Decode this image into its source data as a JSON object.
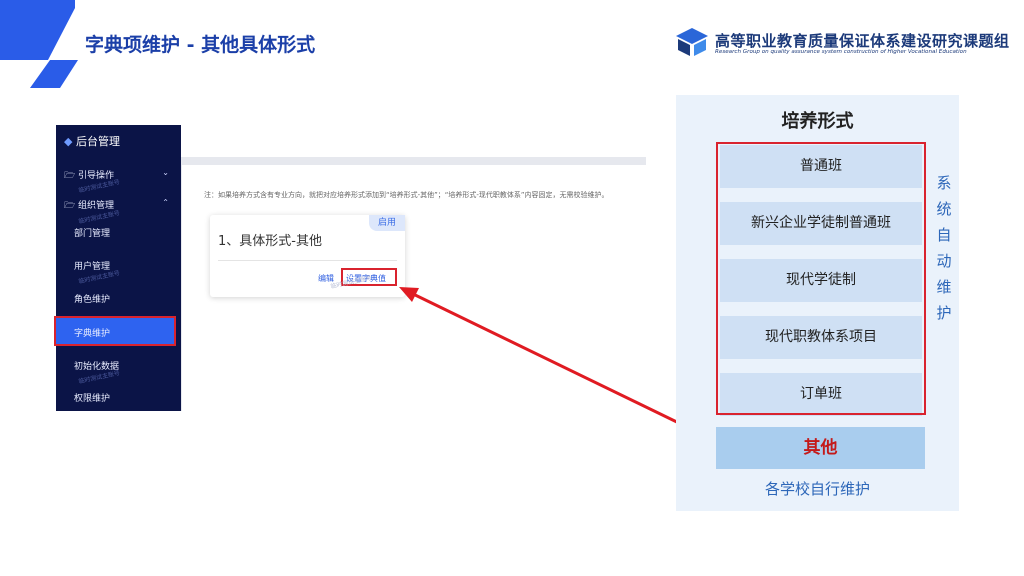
{
  "header": {
    "title": "字典项维护 - 其他具体形式",
    "logo_cn": "高等职业教育质量保证体系建设研究课题组",
    "logo_en": "Research Group on quality assurance system construction of Higher Vocational Education"
  },
  "sidebar": {
    "title": "后台管理",
    "items": [
      {
        "label": "引导操作",
        "icon": "folder-icon",
        "caret": "⌄"
      },
      {
        "label": "组织管理",
        "icon": "folder-icon",
        "caret": "⌃"
      },
      {
        "label": "部门管理"
      },
      {
        "label": "用户管理"
      },
      {
        "label": "角色维护"
      },
      {
        "label": "字典维护"
      },
      {
        "label": "初始化数据"
      },
      {
        "label": "权限维护"
      }
    ],
    "watermark": "临时测试主账号"
  },
  "content": {
    "note": "注：如果培养方式含有专业方向，就把对应培养形式添加到“培养形式-其他”；“培养形式-现代职教体系”内容固定，无需校验维护。",
    "card": {
      "title": "1、具体形式-其他",
      "badge": "启用",
      "edit_link": "编辑",
      "set_link": "设置字典值"
    }
  },
  "right_panel": {
    "title": "培养形式",
    "items": [
      "普通班",
      "新兴企业学徒制普通班",
      "现代学徒制",
      "现代职教体系项目",
      "订单班"
    ],
    "vertical_label": [
      "系",
      "统",
      "自",
      "动",
      "维",
      "护"
    ],
    "other": "其他",
    "bottom": "各学校自行维护"
  },
  "colors": {
    "accent": "#1b3fa8",
    "sidebar_bg": "#0b1447",
    "active": "#2e63f0",
    "highlight": "#d9232e"
  }
}
